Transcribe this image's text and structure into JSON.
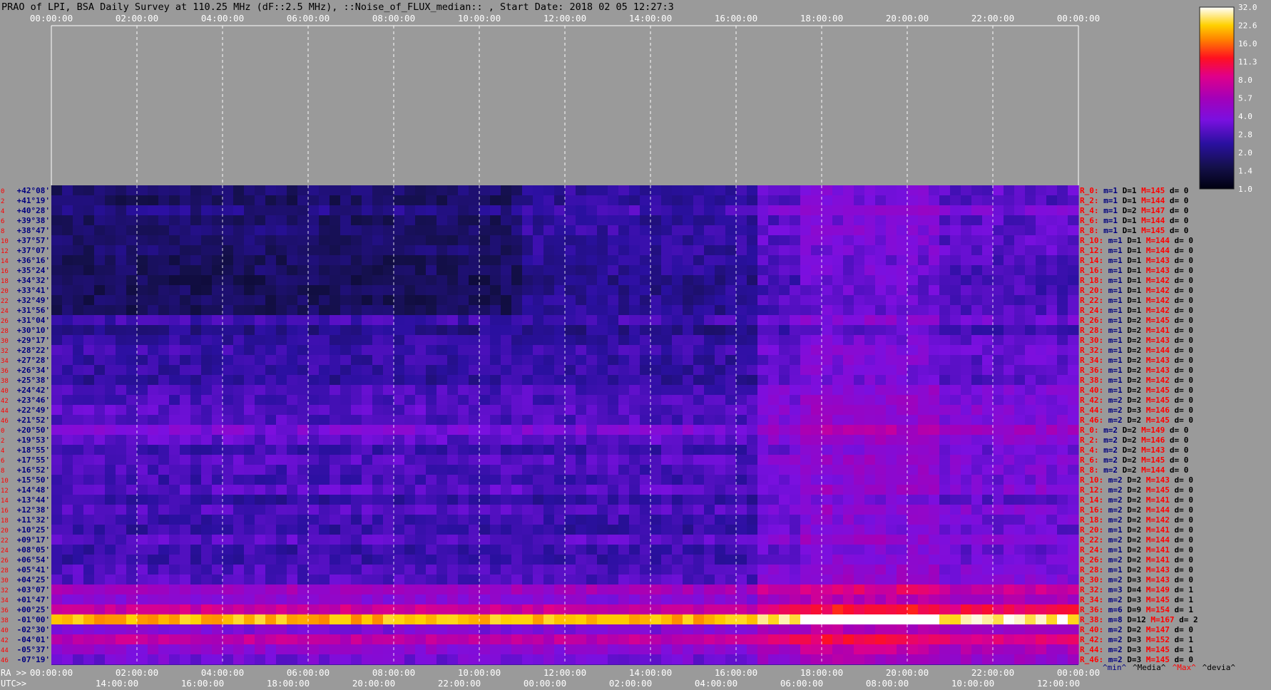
{
  "title": "PRAO of LPI, BSA Daily Survey at 110.25 MHz (dF::2.5 MHz), ::Noise_of_FLUX_median:: , Start Date: 2018 02 05 12:27:3",
  "chart_data": {
    "type": "heatmap",
    "title": "PRAO of LPI, BSA Daily Survey at 110.25 MHz (dF::2.5 MHz), ::Noise_of_FLUX_median:: , Start Date: 2018 02 05 12:27:3",
    "top_axis_labels": [
      "00:00:00",
      "02:00:00",
      "04:00:00",
      "06:00:00",
      "08:00:00",
      "10:00:00",
      "12:00:00",
      "14:00:00",
      "16:00:00",
      "18:00:00",
      "20:00:00",
      "22:00:00",
      "00:00:00"
    ],
    "ra_axis_prefix": "RA >>",
    "ra_axis_labels": [
      "00:00:00",
      "02:00:00",
      "04:00:00",
      "06:00:00",
      "08:00:00",
      "10:00:00",
      "12:00:00",
      "14:00:00",
      "16:00:00",
      "18:00:00",
      "20:00:00",
      "22:00:00",
      "00:00:00"
    ],
    "utc_axis_prefix": "UTC>>",
    "utc_axis_labels": [
      "14:00:00",
      "16:00:00",
      "18:00:00",
      "20:00:00",
      "22:00:00",
      "00:00:00",
      "02:00:00",
      "04:00:00",
      "06:00:00",
      "08:00:00",
      "10:00:00",
      "12:00:00"
    ],
    "rows": [
      {
        "idx": "0",
        "dec": "+42°08'",
        "r": "R_0:",
        "m": "1",
        "D": "1",
        "M": "145",
        "d": "0"
      },
      {
        "idx": "2",
        "dec": "+41°19'",
        "r": "R_2:",
        "m": "1",
        "D": "1",
        "M": "144",
        "d": "0"
      },
      {
        "idx": "4",
        "dec": "+40°28'",
        "r": "R_4:",
        "m": "1",
        "D": "2",
        "M": "147",
        "d": "0"
      },
      {
        "idx": "6",
        "dec": "+39°38'",
        "r": "R_6:",
        "m": "1",
        "D": "1",
        "M": "144",
        "d": "0"
      },
      {
        "idx": "8",
        "dec": "+38°47'",
        "r": "R_8:",
        "m": "1",
        "D": "1",
        "M": "145",
        "d": "0"
      },
      {
        "idx": "10",
        "dec": "+37°57'",
        "r": "R_10:",
        "m": "1",
        "D": "1",
        "M": "144",
        "d": "0"
      },
      {
        "idx": "12",
        "dec": "+37°07'",
        "r": "R_12:",
        "m": "1",
        "D": "1",
        "M": "144",
        "d": "0"
      },
      {
        "idx": "14",
        "dec": "+36°16'",
        "r": "R_14:",
        "m": "1",
        "D": "1",
        "M": "143",
        "d": "0"
      },
      {
        "idx": "16",
        "dec": "+35°24'",
        "r": "R_16:",
        "m": "1",
        "D": "1",
        "M": "143",
        "d": "0"
      },
      {
        "idx": "18",
        "dec": "+34°32'",
        "r": "R_18:",
        "m": "1",
        "D": "1",
        "M": "142",
        "d": "0"
      },
      {
        "idx": "20",
        "dec": "+33°41'",
        "r": "R_20:",
        "m": "1",
        "D": "1",
        "M": "142",
        "d": "0"
      },
      {
        "idx": "22",
        "dec": "+32°49'",
        "r": "R_22:",
        "m": "1",
        "D": "1",
        "M": "142",
        "d": "0"
      },
      {
        "idx": "24",
        "dec": "+31°56'",
        "r": "R_24:",
        "m": "1",
        "D": "1",
        "M": "142",
        "d": "0"
      },
      {
        "idx": "26",
        "dec": "+31°04'",
        "r": "R_26:",
        "m": "1",
        "D": "2",
        "M": "145",
        "d": "0"
      },
      {
        "idx": "28",
        "dec": "+30°10'",
        "r": "R_28:",
        "m": "1",
        "D": "2",
        "M": "141",
        "d": "0"
      },
      {
        "idx": "30",
        "dec": "+29°17'",
        "r": "R_30:",
        "m": "1",
        "D": "2",
        "M": "143",
        "d": "0"
      },
      {
        "idx": "32",
        "dec": "+28°22'",
        "r": "R_32:",
        "m": "1",
        "D": "2",
        "M": "144",
        "d": "0"
      },
      {
        "idx": "34",
        "dec": "+27°28'",
        "r": "R_34:",
        "m": "1",
        "D": "2",
        "M": "143",
        "d": "0"
      },
      {
        "idx": "36",
        "dec": "+26°34'",
        "r": "R_36:",
        "m": "1",
        "D": "2",
        "M": "143",
        "d": "0"
      },
      {
        "idx": "38",
        "dec": "+25°38'",
        "r": "R_38:",
        "m": "1",
        "D": "2",
        "M": "142",
        "d": "0"
      },
      {
        "idx": "40",
        "dec": "+24°42'",
        "r": "R_40:",
        "m": "1",
        "D": "2",
        "M": "145",
        "d": "0"
      },
      {
        "idx": "42",
        "dec": "+23°46'",
        "r": "R_42:",
        "m": "2",
        "D": "2",
        "M": "145",
        "d": "0"
      },
      {
        "idx": "44",
        "dec": "+22°49'",
        "r": "R_44:",
        "m": "2",
        "D": "3",
        "M": "146",
        "d": "0"
      },
      {
        "idx": "46",
        "dec": "+21°52'",
        "r": "R_46:",
        "m": "2",
        "D": "2",
        "M": "145",
        "d": "0"
      },
      {
        "idx": "0",
        "dec": "+20°50'",
        "r": "R_0:",
        "m": "2",
        "D": "2",
        "M": "149",
        "d": "0"
      },
      {
        "idx": "2",
        "dec": "+19°53'",
        "r": "R_2:",
        "m": "2",
        "D": "2",
        "M": "146",
        "d": "0"
      },
      {
        "idx": "4",
        "dec": "+18°55'",
        "r": "R_4:",
        "m": "2",
        "D": "2",
        "M": "143",
        "d": "0"
      },
      {
        "idx": "6",
        "dec": "+17°55'",
        "r": "R_6:",
        "m": "2",
        "D": "2",
        "M": "145",
        "d": "0"
      },
      {
        "idx": "8",
        "dec": "+16°52'",
        "r": "R_8:",
        "m": "2",
        "D": "2",
        "M": "144",
        "d": "0"
      },
      {
        "idx": "10",
        "dec": "+15°50'",
        "r": "R_10:",
        "m": "2",
        "D": "2",
        "M": "143",
        "d": "0"
      },
      {
        "idx": "12",
        "dec": "+14°48'",
        "r": "R_12:",
        "m": "2",
        "D": "2",
        "M": "145",
        "d": "0"
      },
      {
        "idx": "14",
        "dec": "+13°44'",
        "r": "R_14:",
        "m": "2",
        "D": "2",
        "M": "141",
        "d": "0"
      },
      {
        "idx": "16",
        "dec": "+12°38'",
        "r": "R_16:",
        "m": "2",
        "D": "2",
        "M": "144",
        "d": "0"
      },
      {
        "idx": "18",
        "dec": "+11°32'",
        "r": "R_18:",
        "m": "2",
        "D": "2",
        "M": "142",
        "d": "0"
      },
      {
        "idx": "20",
        "dec": "+10°25'",
        "r": "R_20:",
        "m": "1",
        "D": "2",
        "M": "141",
        "d": "0"
      },
      {
        "idx": "22",
        "dec": "+09°17'",
        "r": "R_22:",
        "m": "2",
        "D": "2",
        "M": "144",
        "d": "0"
      },
      {
        "idx": "24",
        "dec": "+08°05'",
        "r": "R_24:",
        "m": "1",
        "D": "2",
        "M": "141",
        "d": "0"
      },
      {
        "idx": "26",
        "dec": "+06°54'",
        "r": "R_26:",
        "m": "2",
        "D": "2",
        "M": "141",
        "d": "0"
      },
      {
        "idx": "28",
        "dec": "+05°41'",
        "r": "R_28:",
        "m": "1",
        "D": "2",
        "M": "143",
        "d": "0"
      },
      {
        "idx": "30",
        "dec": "+04°25'",
        "r": "R_30:",
        "m": "2",
        "D": "3",
        "M": "143",
        "d": "0"
      },
      {
        "idx": "32",
        "dec": "+03°07'",
        "r": "R_32:",
        "m": "3",
        "D": "4",
        "M": "149",
        "d": "1"
      },
      {
        "idx": "34",
        "dec": "+01°47'",
        "r": "R_34:",
        "m": "2",
        "D": "3",
        "M": "145",
        "d": "1"
      },
      {
        "idx": "36",
        "dec": "+00°25'",
        "r": "R_36:",
        "m": "6",
        "D": "9",
        "M": "154",
        "d": "1"
      },
      {
        "idx": "38",
        "dec": "-01°00'",
        "r": "R_38:",
        "m": "8",
        "D": "12",
        "M": "167",
        "d": "2"
      },
      {
        "idx": "40",
        "dec": "-02°30'",
        "r": "R_40:",
        "m": "2",
        "D": "2",
        "M": "147",
        "d": "0"
      },
      {
        "idx": "42",
        "dec": "-04°01'",
        "r": "R_42:",
        "m": "2",
        "D": "3",
        "M": "152",
        "d": "1"
      },
      {
        "idx": "44",
        "dec": "-05°37'",
        "r": "R_44:",
        "m": "2",
        "D": "3",
        "M": "145",
        "d": "1"
      },
      {
        "idx": "46",
        "dec": "-07°19'",
        "r": "R_46:",
        "m": "2",
        "D": "3",
        "M": "145",
        "d": "0"
      }
    ],
    "stat_labels": {
      "m": "m=",
      "D": "D=",
      "M": "M=",
      "d": "d= "
    },
    "stat_legend": [
      {
        "text": "^min^",
        "color": "#000080"
      },
      {
        "text": "^Media^",
        "color": "#000000"
      },
      {
        "text": "^Max^",
        "color": "#ff0000"
      },
      {
        "text": "^devia^",
        "color": "#000000"
      }
    ],
    "colorbar": {
      "ticks": [
        "32.0",
        "22.6",
        "16.0",
        "11.3",
        "8.0",
        "5.7",
        "4.0",
        "2.8",
        "2.0",
        "1.4",
        "1.0"
      ],
      "scale": "log"
    },
    "colors": {
      "background": "#9a9a9a",
      "dec_label": "#000080",
      "row_index": "#ff0000",
      "r_label": "#ff0000",
      "m_value": "#000080",
      "D_value": "#000000",
      "M_value": "#ff0000"
    }
  }
}
